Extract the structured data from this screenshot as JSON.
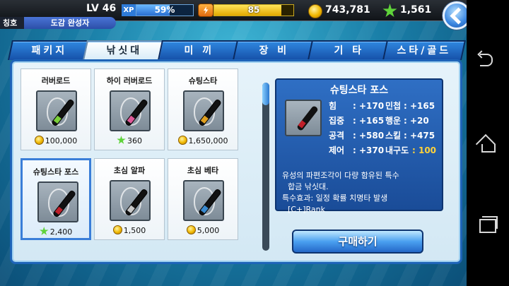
{
  "player": {
    "level_label": "LV 46",
    "xp_label": "XP",
    "xp_percent_text": "59%",
    "xp_fraction": 0.59,
    "energy_value": "85",
    "energy_fraction": 0.85,
    "gold": "743,781",
    "stars": "1,561",
    "title_label": "칭호",
    "title_value": "도감 완성자"
  },
  "tabs": [
    {
      "label": "패키지",
      "active": false
    },
    {
      "label": "낚싯대",
      "active": true
    },
    {
      "label": "미 끼",
      "active": false
    },
    {
      "label": "장 비",
      "active": false
    },
    {
      "label": "기 타",
      "active": false
    },
    {
      "label": "스타/골드",
      "active": false
    }
  ],
  "items": [
    {
      "name": "러버로드",
      "currency": "coin",
      "price": "100,000",
      "band_color": "#7bd13a",
      "selected": false
    },
    {
      "name": "하이 러버로드",
      "currency": "star",
      "price": "360",
      "band_color": "#e05a9a",
      "selected": false
    },
    {
      "name": "슈팅스타",
      "currency": "coin",
      "price": "1,650,000",
      "band_color": "#e0a020",
      "selected": false
    },
    {
      "name": "슈팅스타 포스",
      "currency": "star",
      "price": "2,400",
      "band_color": "#c0202a",
      "selected": true
    },
    {
      "name": "초심 알파",
      "currency": "coin",
      "price": "1,500",
      "band_color": "#c8c8c8",
      "selected": false
    },
    {
      "name": "초심 베타",
      "currency": "coin",
      "price": "5,000",
      "band_color": "#3a8ad0",
      "selected": false
    }
  ],
  "scroll_position": 0.0,
  "detail": {
    "title": "슈팅스타 포스",
    "stats": [
      [
        {
          "label": "힘",
          "value": ": +170"
        },
        {
          "label": "민첩",
          "value": ": +165"
        }
      ],
      [
        {
          "label": "집중",
          "value": ": +165"
        },
        {
          "label": "행운",
          "value": ": +20"
        }
      ],
      [
        {
          "label": "공격",
          "value": ": +580"
        },
        {
          "label": "스킬",
          "value": ": +475"
        }
      ],
      [
        {
          "label": "제어",
          "value": ": +370"
        },
        {
          "label": "내구도",
          "value": ": 100",
          "highlight": true
        }
      ]
    ],
    "description_lines": [
      "유성의 파편조각이 다량 함유된 특수",
      "합금 낚싯대.",
      "특수효과: 일정 확률 치명타 발생",
      "[C+]Rank"
    ]
  },
  "buy_label": "구매하기"
}
